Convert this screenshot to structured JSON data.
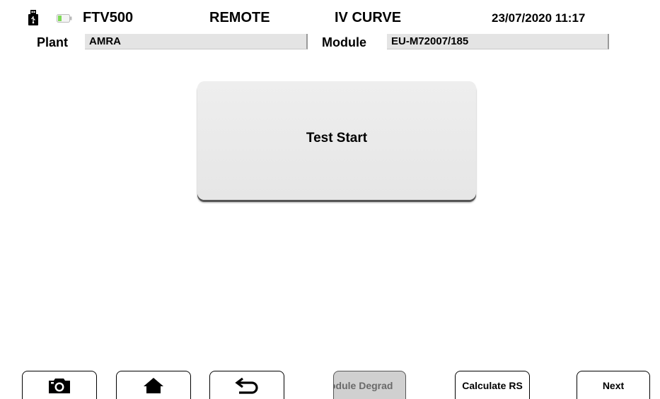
{
  "header": {
    "device": "FTV500",
    "mode": "REMOTE",
    "screen": "IV CURVE",
    "datetime": "23/07/2020 11:17",
    "icons": [
      "usb-icon",
      "battery-icon"
    ],
    "battery_color": "#7ed957"
  },
  "fields": {
    "plant_label": "Plant",
    "plant_value": "AMRA",
    "module_label": "Module",
    "module_value": "EU-M72007/185"
  },
  "main": {
    "test_start_label": "Test Start"
  },
  "toolbar": {
    "camera_icon": "camera-icon",
    "home_icon": "home-icon",
    "back_icon": "back-arrow-icon",
    "module_degradation_label": "odule Degrad",
    "calculate_rs_label": "Calculate RS",
    "next_label": "Next"
  }
}
